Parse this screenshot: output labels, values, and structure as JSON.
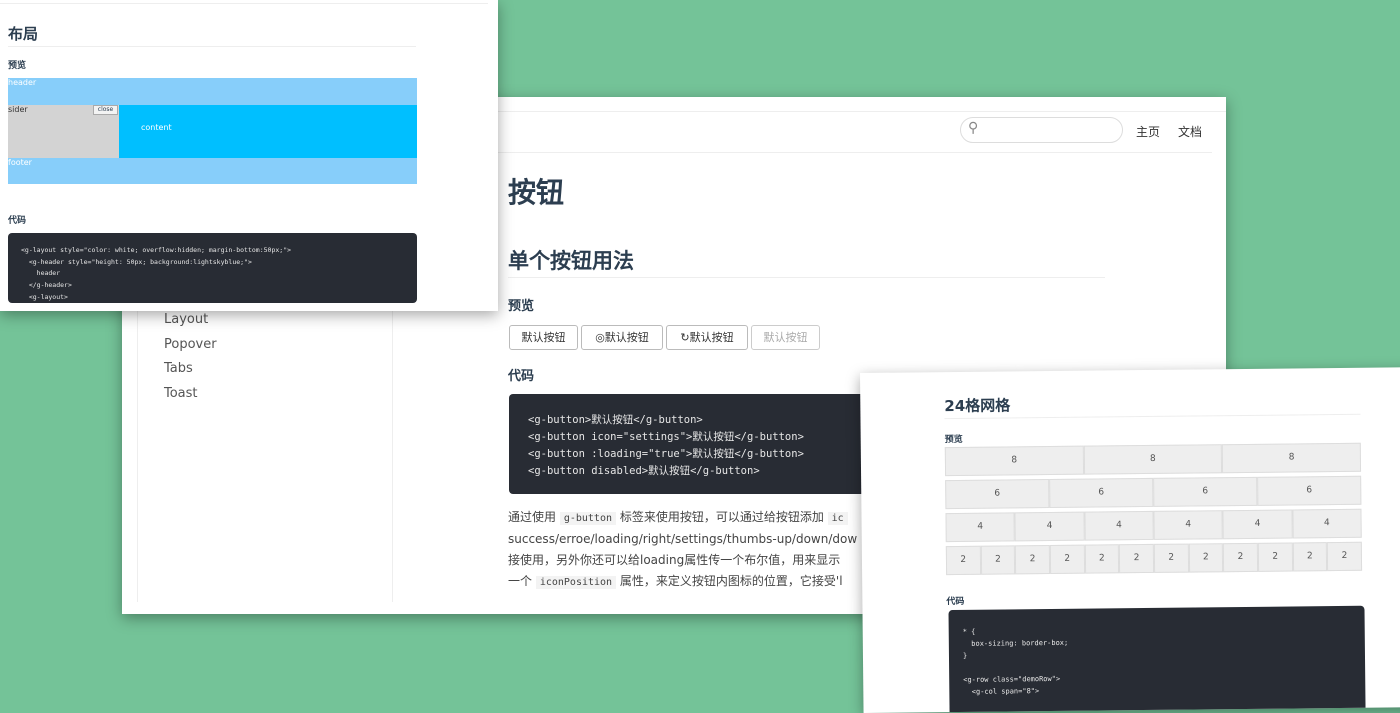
{
  "buttons_page": {
    "nav": {
      "search_placeholder": "",
      "home": "主页",
      "docs": "文档"
    },
    "sidebar": [
      "Layout",
      "Popover",
      "Tabs",
      "Toast"
    ],
    "title": "按钮",
    "section": "单个按钮用法",
    "preview_label": "预览",
    "code_label": "代码",
    "buttons": [
      {
        "label": "默认按钮",
        "icon": ""
      },
      {
        "label": "默认按钮",
        "icon": "settings-icon"
      },
      {
        "label": "默认按钮",
        "icon": "loading-icon"
      },
      {
        "label": "默认按钮",
        "icon": "",
        "disabled": true
      }
    ],
    "code": "<g-button>默认按钮</g-button>\n<g-button icon=\"settings\">默认按钮</g-button>\n<g-button :loading=\"true\">默认按钮</g-button>\n<g-button disabled>默认按钮</g-button>",
    "para": {
      "l1a": "通过使用 ",
      "l1code": "g-button",
      "l1b": " 标签来使用按钮，可以通过给按钮添加 ",
      "l1code2": "ic",
      "l2": "success/erroe/loading/right/settings/thumbs-up/down/downl",
      "l3": "接使用，另外你还可以给loading属性传一个布尔值，用来显示",
      "l4a": "一个 ",
      "l4code": "iconPosition",
      "l4b": " 属性，来定义按钮内图标的位置，它接受'l"
    }
  },
  "layout_page": {
    "title": "布局",
    "preview_label": "预览",
    "code_label": "代码",
    "demo": {
      "header": "header",
      "sider": "sider",
      "close": "close",
      "content": "content",
      "footer": "footer"
    },
    "code": "<g-layout style=\"color: white; overflow:hidden; margin-bottom:50px;\">\n  <g-header style=\"height: 50px; background:lightskyblue;\">\n    header\n  </g-header>\n  <g-layout>"
  },
  "grid_page": {
    "title": "24格网格",
    "preview_label": "预览",
    "code_label": "代码",
    "rows": [
      [
        8,
        8,
        8
      ],
      [
        6,
        6,
        6,
        6
      ],
      [
        4,
        4,
        4,
        4,
        4,
        4
      ],
      [
        2,
        2,
        2,
        2,
        2,
        2,
        2,
        2,
        2,
        2,
        2,
        2
      ]
    ],
    "code": "* {\n  box-sizing: border-box;\n}\n\n<g-row class=\"demoRow\">\n  <g-col span=\"8\">"
  }
}
